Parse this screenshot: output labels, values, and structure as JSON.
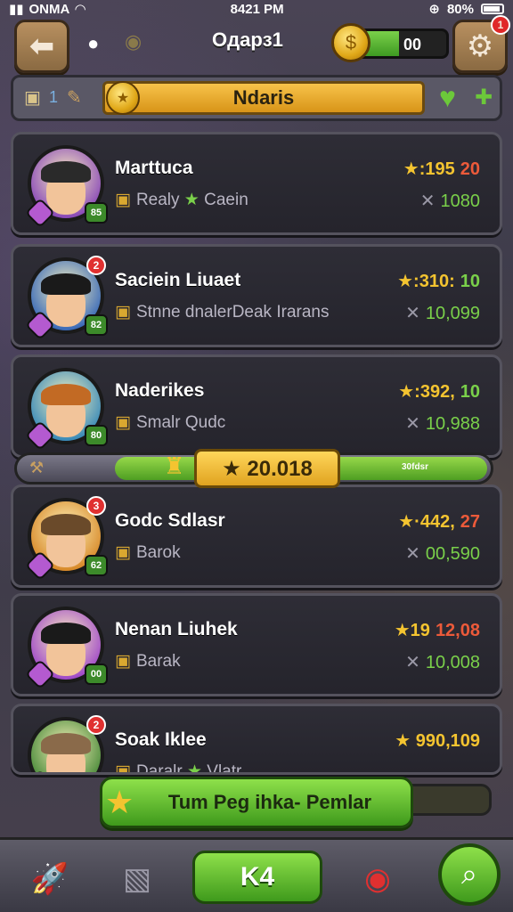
{
  "status_bar": {
    "carrier": "ONMA",
    "time": "8421 PM",
    "battery": "80%"
  },
  "header": {
    "title": "Oдapз1",
    "coin_value": "00",
    "coin_fill_percent": 55,
    "settings_badge": "1"
  },
  "banner": {
    "left_count": "1",
    "label": "Ndaris"
  },
  "leaderboard": [
    {
      "name": "Marttuca",
      "sub": "Realy",
      "sub2": "Caein",
      "score_a": "★:195",
      "score_b": "20",
      "points": "1080",
      "level": "85",
      "hair": "#2a2a2a",
      "ring": "#8a4ab8"
    },
    {
      "name": "Saciein Liuaet",
      "sub": "Stnne dnalerDeak Irarans",
      "score_a": "★:310:",
      "score_b": "10",
      "points": "10,099",
      "level": "82",
      "alert": "2",
      "hair": "#1a1a1a",
      "ring": "#3a6ab8"
    },
    {
      "name": "Naderikes",
      "sub": "Smalr Qudc",
      "score_a": "★:392,",
      "score_b": "10",
      "points": "10,988",
      "level": "80",
      "hair": "#c26a24",
      "ring": "#3a8ab8"
    },
    {
      "name": "Godc Sdlasr",
      "sub": "Barok",
      "score_a": "★·442,",
      "score_b": "27",
      "points": "00,590",
      "level": "62",
      "alert": "3",
      "hair": "#6a4a2a",
      "ring": "#d88a2a"
    },
    {
      "name": "Nenan Liuhek",
      "sub": "Barak",
      "score_a": "★19",
      "score_b": "12,08",
      "points": "10,008",
      "level": "00",
      "hair": "#1a1a1a",
      "ring": "#a04ac8"
    },
    {
      "name": "Soak Iklee",
      "sub": "Daralr",
      "sub2": "Vlatr",
      "score_a": "★ 990,109",
      "score_b": "",
      "points": "",
      "level": "",
      "alert": "2",
      "hair": "#8a6a4a",
      "ring": "#4a8a3a"
    }
  ],
  "highlight": {
    "value": "★ 20.018",
    "tiny_label": "30fdsr"
  },
  "cta": {
    "label": "Tum Peg ihka- Pemlar"
  },
  "bottom_nav": {
    "play_label": "K4"
  },
  "colors": {
    "accent_green": "#6cc83a",
    "gold": "#f4c430",
    "alert_red": "#e03030"
  }
}
